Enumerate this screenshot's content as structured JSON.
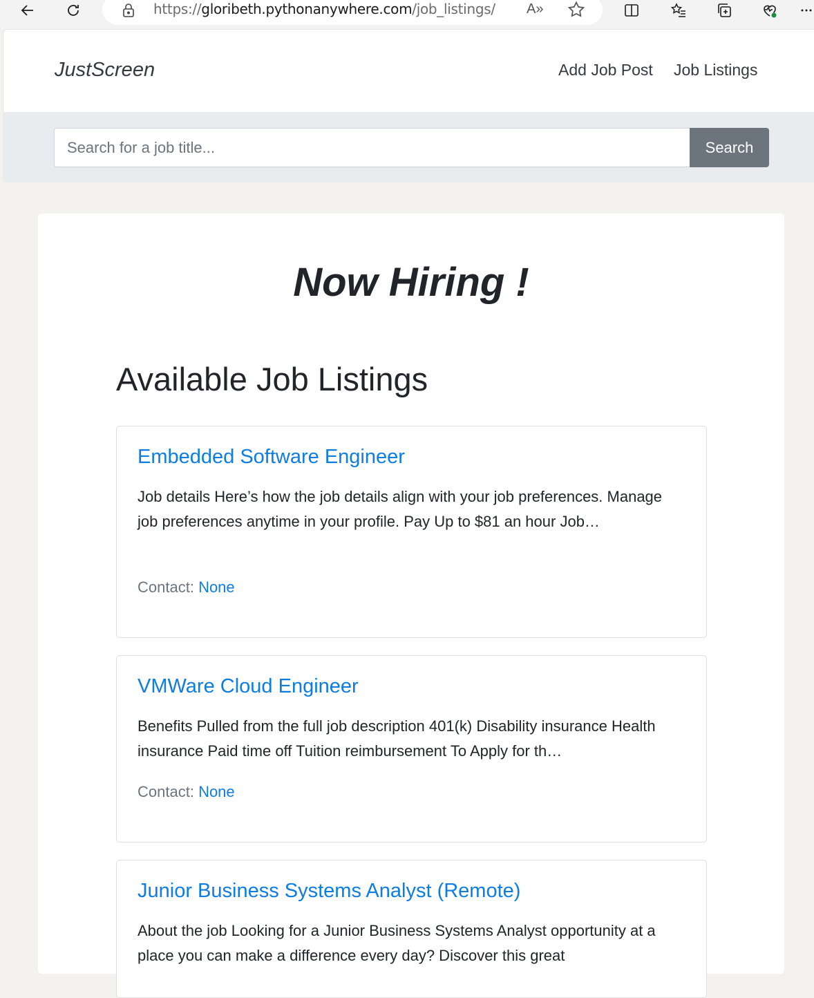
{
  "browser": {
    "url_prefix": "https://",
    "url_host": "gloribeth.pythonanywhere.com",
    "url_path": "/job_listings/",
    "read_aloud_label": "A»"
  },
  "navbar": {
    "brand": "JustScreen",
    "links": [
      {
        "label": "Add Job Post"
      },
      {
        "label": "Job Listings"
      }
    ]
  },
  "search": {
    "placeholder": "Search for a job title...",
    "button_label": "Search"
  },
  "main": {
    "hero_title": "Now Hiring !",
    "section_title": "Available Job Listings",
    "contact_label": "Contact:",
    "jobs": [
      {
        "title": "Embedded Software Engineer",
        "description": "Job details Here’s how the job details align with your job preferences. Manage job preferences anytime in your profile. Pay Up to $81 an hour Job…",
        "contact": "None"
      },
      {
        "title": "VMWare Cloud Engineer",
        "description": "Benefits Pulled from the full job description 401(k) Disability insurance Health insurance Paid time off Tuition reimbursement To Apply for th…",
        "contact": "None"
      },
      {
        "title": "Junior Business Systems Analyst (Remote)",
        "description": "About the job Looking for a Junior Business Systems Analyst opportunity at a place you can make a difference every day? Discover this great",
        "contact": ""
      }
    ]
  }
}
